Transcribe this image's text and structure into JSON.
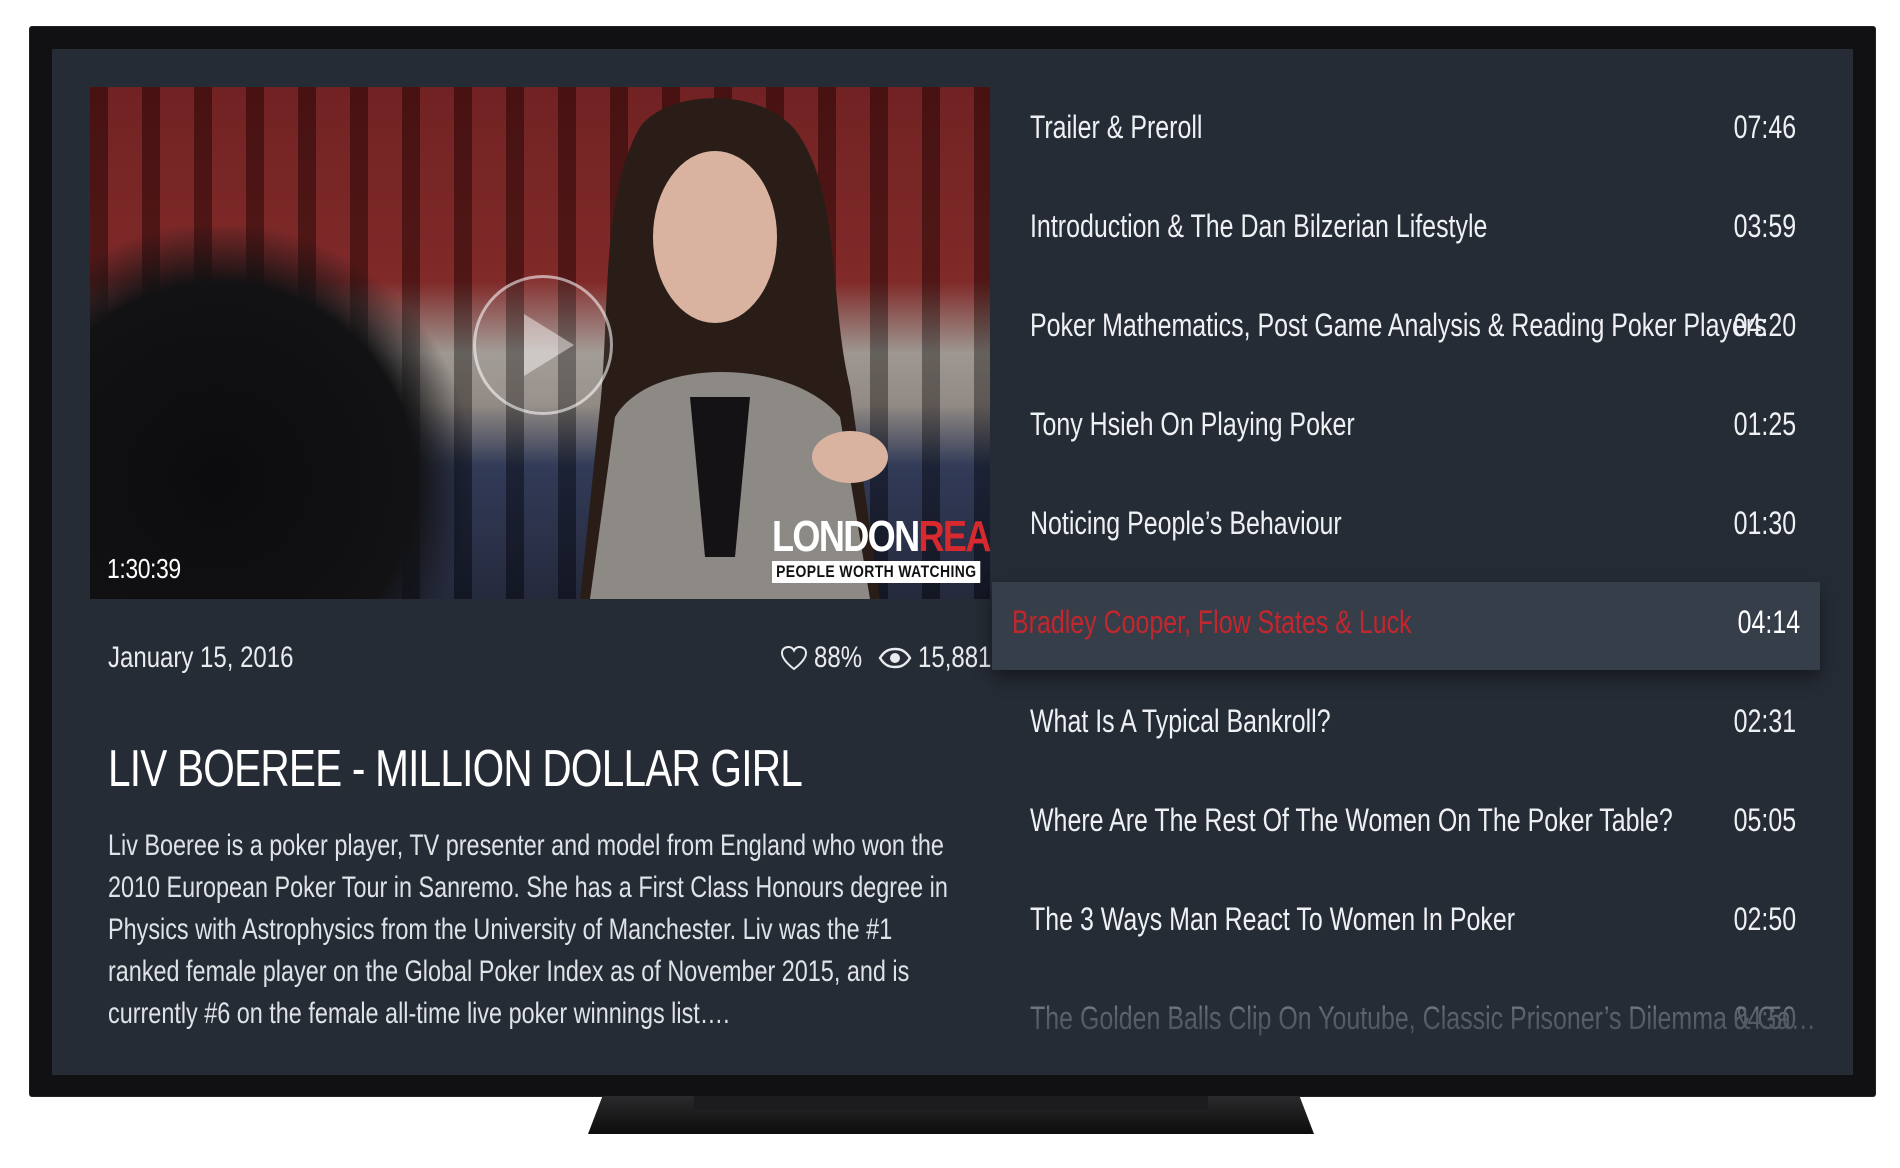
{
  "video": {
    "duration": "1:30:39",
    "logo_brand_white": "LONDON",
    "logo_brand_red": "REAL",
    "logo_tagline": "PEOPLE WORTH WATCHING"
  },
  "meta": {
    "date": "January 15, 2016",
    "likes": "88%",
    "views": "15,881"
  },
  "episode": {
    "title": "LIV BOEREE - MILLION DOLLAR GIRL",
    "description": "Liv Boeree is a poker player, TV presenter and model from England who won the 2010 European Poker Tour in Sanremo. She has a First Class Honours degree in Physics with Astrophysics from the University of Manchester. Liv was the #1 ranked female player on the Global Poker Index as of November 2015, and is currently #6 on the female all-time live poker winnings list…."
  },
  "chapters": [
    {
      "title": "Trailer & Preroll",
      "time": "07:46"
    },
    {
      "title": "Introduction & The Dan Bilzerian Lifestyle",
      "time": "03:59"
    },
    {
      "title": "Poker Mathematics, Post Game Analysis & Reading Poker Players",
      "time": "04:20"
    },
    {
      "title": "Tony Hsieh On Playing Poker",
      "time": "01:25"
    },
    {
      "title": "Noticing People’s Behaviour",
      "time": "01:30"
    },
    {
      "title": "Bradley Cooper, Flow States & Luck",
      "time": "04:14"
    },
    {
      "title": "What Is A Typical Bankroll?",
      "time": "02:31"
    },
    {
      "title": "Where Are The Rest Of The Women On The Poker Table?",
      "time": "05:05"
    },
    {
      "title": "The 3 Ways Man React To Women In Poker",
      "time": "02:50"
    },
    {
      "title": "The Golden Balls Clip On Youtube, Classic Prisoner’s Dilemma & Ga…",
      "time": "04:50"
    }
  ],
  "active_chapter_index": 5,
  "colors": {
    "screen_bg": "#262c36",
    "active_row_bg": "#363e4a",
    "active_title": "#c4262d"
  }
}
